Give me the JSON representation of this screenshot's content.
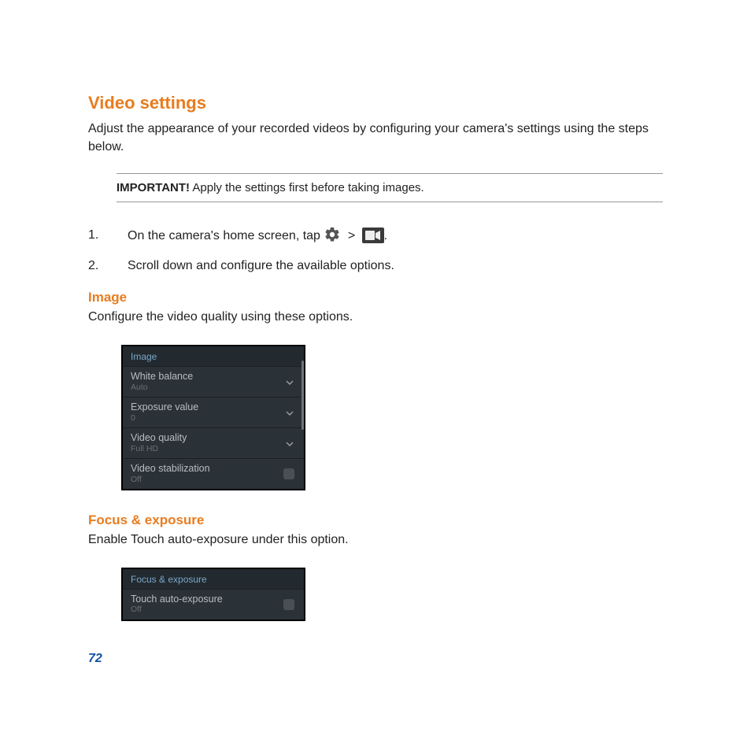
{
  "heading": "Video settings",
  "intro": "Adjust the appearance of your recorded videos by configuring your camera's settings using the steps below.",
  "note": {
    "label": "IMPORTANT!",
    "text": "  Apply the settings first before taking images."
  },
  "steps": {
    "s1_pre": "On the camera's home screen, tap ",
    "s1_gt": ">",
    "s1_post": ".",
    "s2": "Scroll down and configure the available options."
  },
  "image_section": {
    "title": "Image",
    "desc": "Configure the video quality using these options.",
    "panel_header": "Image",
    "rows": [
      {
        "label": "White balance",
        "value": "Auto",
        "control": "chevron"
      },
      {
        "label": "Exposure value",
        "value": "0",
        "control": "chevron"
      },
      {
        "label": "Video quality",
        "value": "Full HD",
        "control": "chevron"
      },
      {
        "label": "Video stabilization",
        "value": "Off",
        "control": "checkbox"
      }
    ]
  },
  "focus_section": {
    "title": "Focus & exposure",
    "desc": "Enable Touch auto-exposure under this option.",
    "panel_header": "Focus & exposure",
    "rows": [
      {
        "label": "Touch auto-exposure",
        "value": "Off",
        "control": "checkbox"
      }
    ]
  },
  "page_number": "72"
}
